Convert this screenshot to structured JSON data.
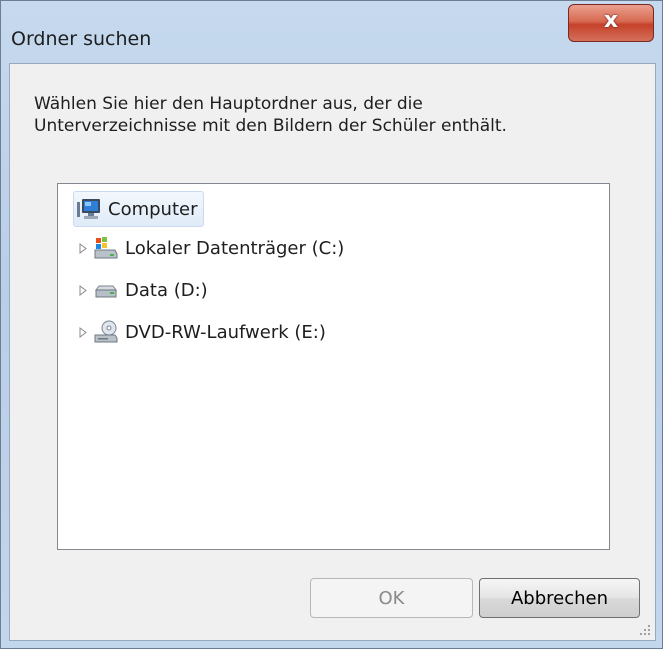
{
  "window": {
    "title": "Ordner suchen",
    "close_glyph": "x"
  },
  "description": {
    "line1": "Wählen Sie hier den Hauptordner aus, der die",
    "line2": "Unterverzeichnisse mit den Bildern der Schüler enthält."
  },
  "tree": {
    "root": {
      "label": "Computer",
      "icon": "computer-icon",
      "selected": true
    },
    "items": [
      {
        "label": "Lokaler Datenträger (C:)",
        "icon": "windows-drive-icon"
      },
      {
        "label": "Data (D:)",
        "icon": "hard-drive-icon"
      },
      {
        "label": "DVD-RW-Laufwerk (E:)",
        "icon": "dvd-drive-icon"
      }
    ]
  },
  "buttons": {
    "ok_label": "OK",
    "ok_enabled": false,
    "cancel_label": "Abbrechen"
  },
  "colors": {
    "title_bar": "#c6d9ee",
    "close_button": "#d86a52",
    "client_bg": "#f0f0f0",
    "selection": "#dfebf8"
  }
}
